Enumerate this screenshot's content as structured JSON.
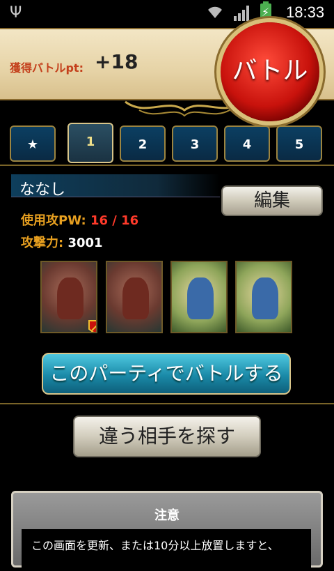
{
  "status_bar": {
    "time": "18:33",
    "icons": [
      "usb-icon",
      "wifi-icon",
      "signal-icon",
      "battery-charging-icon"
    ]
  },
  "banner": {
    "pt_label": "獲得バトルpt:",
    "pt_value": "+18",
    "battle_button": "バトル"
  },
  "tabs": [
    "★",
    "1",
    "2",
    "3",
    "4",
    "5"
  ],
  "active_tab": "1",
  "party": {
    "name": "ななし",
    "edit_label": "編集",
    "attack_pw_label": "使用攻PW:",
    "attack_pw_value": "16 / 16",
    "attack_power_label": "攻撃力:",
    "attack_power_value": "3001",
    "cards": [
      "demon",
      "demon",
      "fairy",
      "fairy"
    ]
  },
  "buttons": {
    "battle_with_party": "このパーティでバトルする",
    "find_other": "違う相手を探す"
  },
  "notice": {
    "title": "注意",
    "text": "この画面を更新、または10分以上放置しますと、"
  },
  "colors": {
    "accent_gold": "#9c8440",
    "tab_blue": "#0b3f62",
    "battle_red": "#c8120c",
    "cta_cyan": "#1a8aa8"
  }
}
